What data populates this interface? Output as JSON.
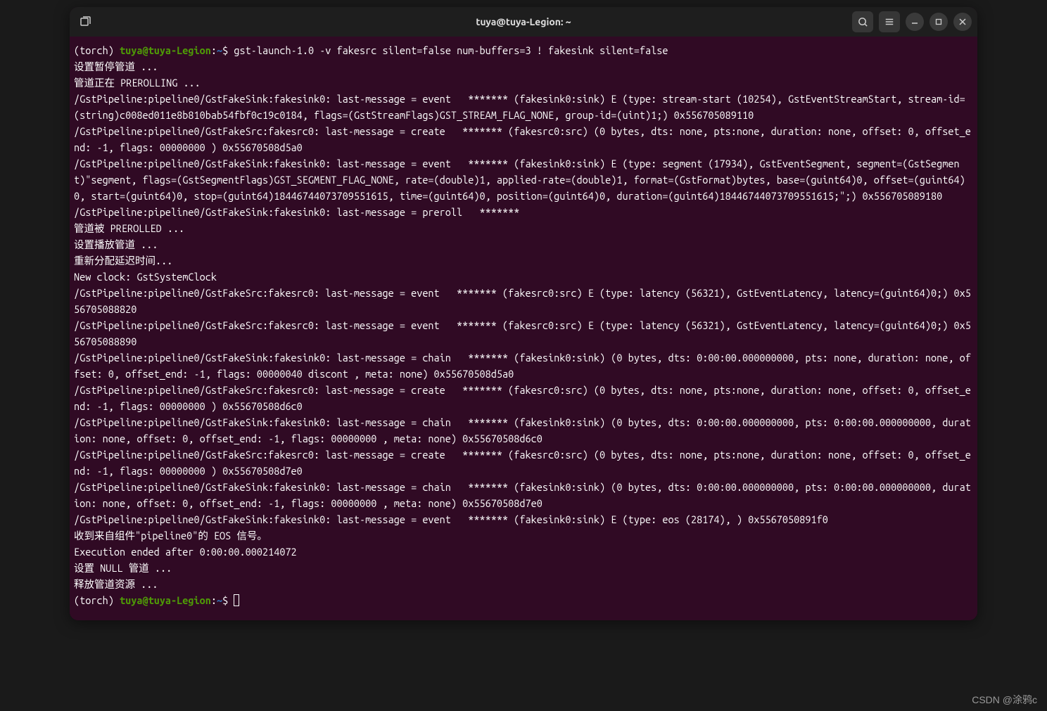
{
  "window": {
    "title": "tuya@tuya-Legion: ~"
  },
  "prompt": {
    "env": "(torch) ",
    "user_host": "tuya@tuya-Legion",
    "colon": ":",
    "path": "~",
    "dollar": "$ "
  },
  "command": "gst-launch-1.0 -v fakesrc silent=false num-buffers=3 ! fakesink silent=false",
  "output": [
    "设置暂停管道 ...",
    "管道正在 PREROLLING ...",
    "/GstPipeline:pipeline0/GstFakeSink:fakesink0: last-message = event   ******* (fakesink0:sink) E (type: stream-start (10254), GstEventStreamStart, stream-id=(string)c008ed011e8b810bab54fbf0c19c0184, flags=(GstStreamFlags)GST_STREAM_FLAG_NONE, group-id=(uint)1;) 0x556705089110",
    "/GstPipeline:pipeline0/GstFakeSrc:fakesrc0: last-message = create   ******* (fakesrc0:src) (0 bytes, dts: none, pts:none, duration: none, offset: 0, offset_end: -1, flags: 00000000 ) 0x55670508d5a0",
    "/GstPipeline:pipeline0/GstFakeSink:fakesink0: last-message = event   ******* (fakesink0:sink) E (type: segment (17934), GstEventSegment, segment=(GstSegment)\"segment, flags=(GstSegmentFlags)GST_SEGMENT_FLAG_NONE, rate=(double)1, applied-rate=(double)1, format=(GstFormat)bytes, base=(guint64)0, offset=(guint64)0, start=(guint64)0, stop=(guint64)18446744073709551615, time=(guint64)0, position=(guint64)0, duration=(guint64)18446744073709551615;\";) 0x556705089180",
    "/GstPipeline:pipeline0/GstFakeSink:fakesink0: last-message = preroll   *******",
    "管道被 PREROLLED ...",
    "设置播放管道 ...",
    "重新分配延迟时间...",
    "New clock: GstSystemClock",
    "/GstPipeline:pipeline0/GstFakeSrc:fakesrc0: last-message = event   ******* (fakesrc0:src) E (type: latency (56321), GstEventLatency, latency=(guint64)0;) 0x556705088820",
    "/GstPipeline:pipeline0/GstFakeSrc:fakesrc0: last-message = event   ******* (fakesrc0:src) E (type: latency (56321), GstEventLatency, latency=(guint64)0;) 0x556705088890",
    "/GstPipeline:pipeline0/GstFakeSink:fakesink0: last-message = chain   ******* (fakesink0:sink) (0 bytes, dts: 0:00:00.000000000, pts: none, duration: none, offset: 0, offset_end: -1, flags: 00000040 discont , meta: none) 0x55670508d5a0",
    "/GstPipeline:pipeline0/GstFakeSrc:fakesrc0: last-message = create   ******* (fakesrc0:src) (0 bytes, dts: none, pts:none, duration: none, offset: 0, offset_end: -1, flags: 00000000 ) 0x55670508d6c0",
    "/GstPipeline:pipeline0/GstFakeSink:fakesink0: last-message = chain   ******* (fakesink0:sink) (0 bytes, dts: 0:00:00.000000000, pts: 0:00:00.000000000, duration: none, offset: 0, offset_end: -1, flags: 00000000 , meta: none) 0x55670508d6c0",
    "/GstPipeline:pipeline0/GstFakeSrc:fakesrc0: last-message = create   ******* (fakesrc0:src) (0 bytes, dts: none, pts:none, duration: none, offset: 0, offset_end: -1, flags: 00000000 ) 0x55670508d7e0",
    "/GstPipeline:pipeline0/GstFakeSink:fakesink0: last-message = chain   ******* (fakesink0:sink) (0 bytes, dts: 0:00:00.000000000, pts: 0:00:00.000000000, duration: none, offset: 0, offset_end: -1, flags: 00000000 , meta: none) 0x55670508d7e0",
    "/GstPipeline:pipeline0/GstFakeSink:fakesink0: last-message = event   ******* (fakesink0:sink) E (type: eos (28174), ) 0x5567050891f0",
    "收到来自组件\"pipeline0\"的 EOS 信号。",
    "Execution ended after 0:00:00.000214072",
    "设置 NULL 管道 ...",
    "释放管道资源 ..."
  ],
  "watermark": "CSDN @涂鸦c"
}
